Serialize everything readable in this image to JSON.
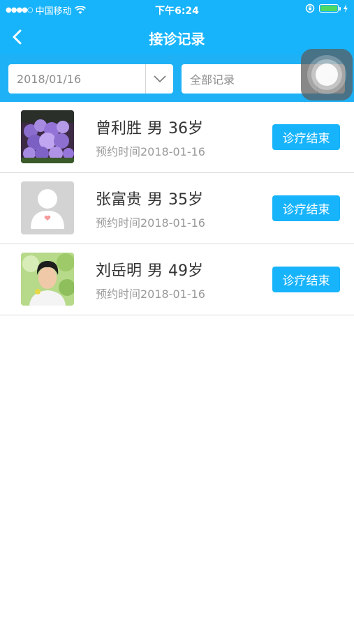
{
  "status_bar": {
    "carrier": "中国移动",
    "time": "下午6:24"
  },
  "nav": {
    "title": "接诊记录",
    "back_icon": "chevron-left-icon"
  },
  "filters": {
    "date_value": "2018/01/16",
    "type_value": "全部记录"
  },
  "records": [
    {
      "name": "曾利胜",
      "gender": "男",
      "age": "36岁",
      "appointment": "预约时间2018-01-16",
      "action": "诊疗结束",
      "avatar": "lilac-flowers-photo"
    },
    {
      "name": "张富贵",
      "gender": "男",
      "age": "35岁",
      "appointment": "预约时间2018-01-16",
      "action": "诊疗结束",
      "avatar": "default-person-placeholder"
    },
    {
      "name": "刘岳明",
      "gender": "男",
      "age": "49岁",
      "appointment": "预约时间2018-01-16",
      "action": "诊疗结束",
      "avatar": "young-man-photo"
    }
  ],
  "colors": {
    "accent": "#18b4fb",
    "divider": "#dcdcdc"
  }
}
